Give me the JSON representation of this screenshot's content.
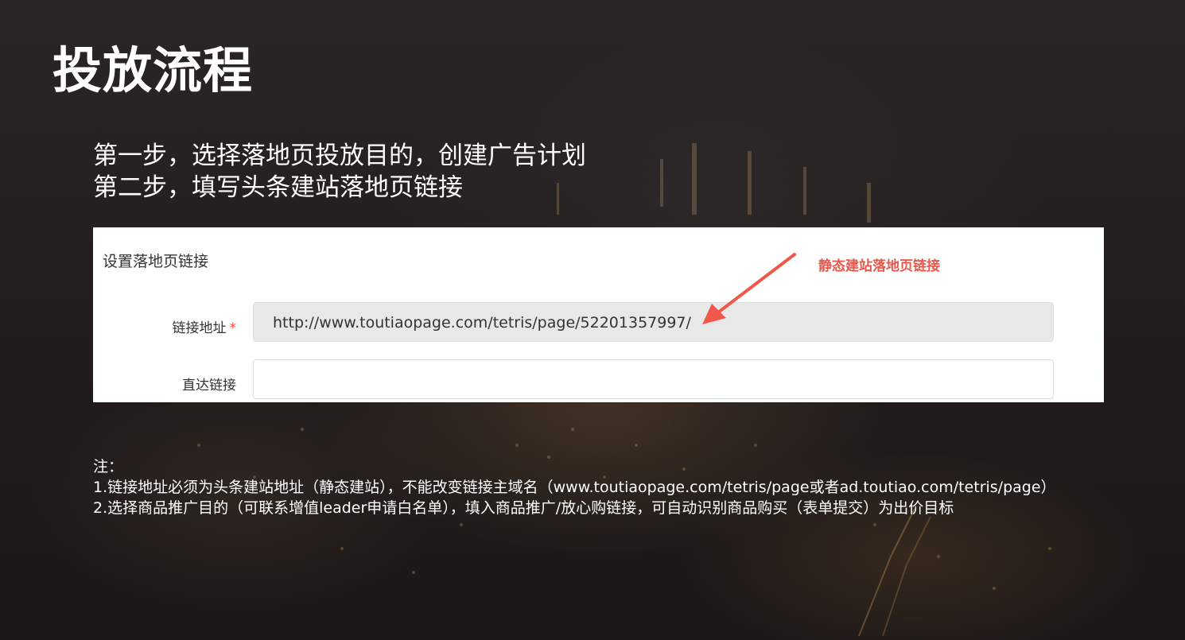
{
  "slide": {
    "title": "投放流程",
    "steps": [
      "第一步，选择落地页投放目的，创建广告计划",
      "第二步，填写头条建站落地页链接"
    ]
  },
  "form": {
    "section_title": "设置落地页链接",
    "link_address": {
      "label": "链接地址",
      "required_mark": "*",
      "value": "http://www.toutiaopage.com/tetris/page/52201357997/"
    },
    "direct_link": {
      "label": "直达链接",
      "value": ""
    }
  },
  "annotation": {
    "text": "静态建站落地页链接",
    "color": "#e8584b"
  },
  "notes": {
    "heading": "注：",
    "items": [
      "1.链接地址必须为头条建站地址（静态建站），不能改变链接主域名（www.toutiaopage.com/tetris/page或者ad.toutiao.com/tetris/page）",
      "2.选择商品推广目的（可联系增值leader申请白名单），填入商品推广/放心购链接，可自动识别商品购买（表单提交）为出价目标"
    ]
  }
}
